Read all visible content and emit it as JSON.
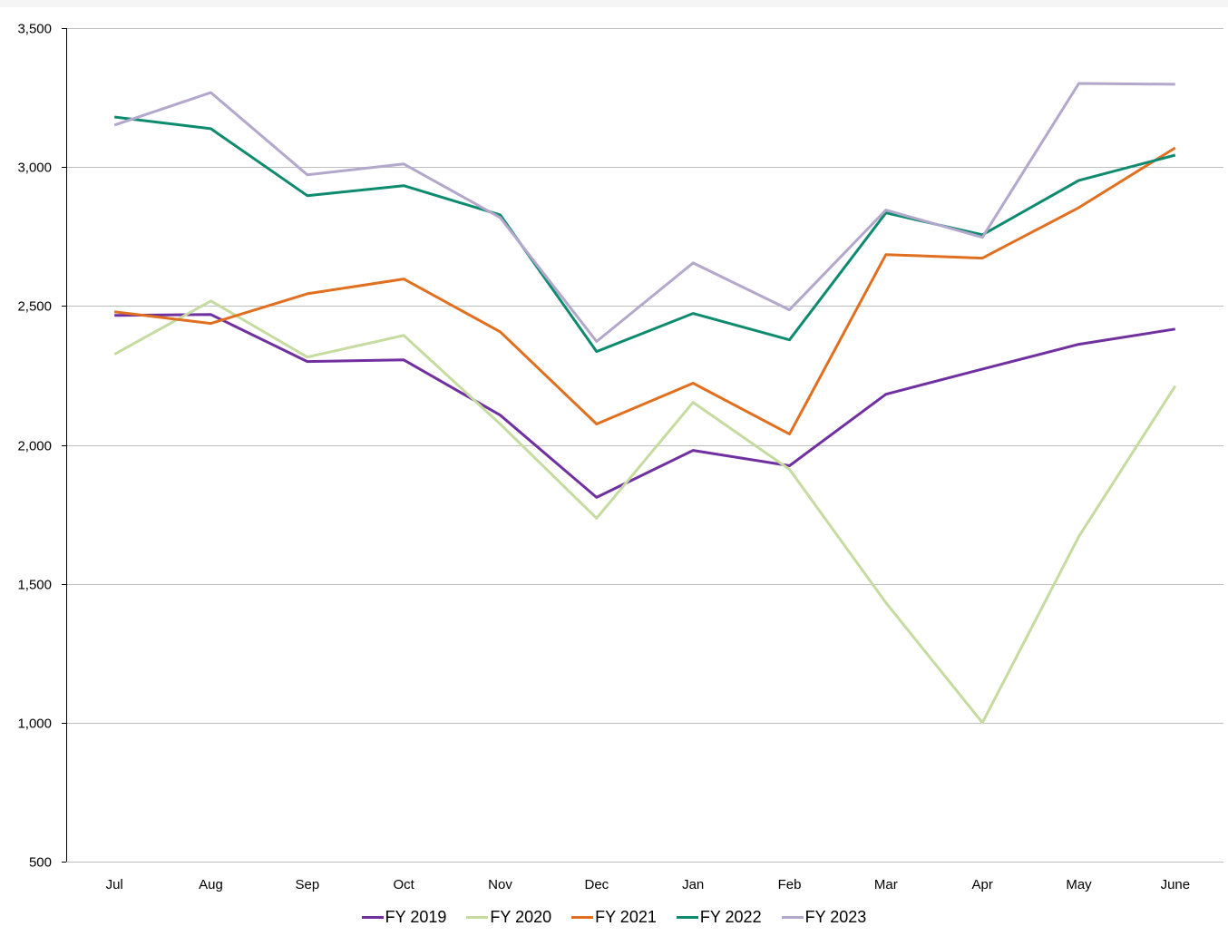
{
  "chart_data": {
    "type": "line",
    "title": "",
    "xlabel": "",
    "ylabel": "",
    "categories": [
      "Jul",
      "Aug",
      "Sep",
      "Oct",
      "Nov",
      "Dec",
      "Jan",
      "Feb",
      "Mar",
      "Apr",
      "May",
      "June"
    ],
    "ylim": [
      500,
      3500
    ],
    "yticks": [
      500,
      1000,
      1500,
      2000,
      2500,
      3000,
      3500
    ],
    "ytick_labels": [
      "500",
      "1,000",
      "1,500",
      "2,000",
      "2,500",
      "3,000",
      "3,500"
    ],
    "grid": "horizontal",
    "legend_position": "bottom",
    "series": [
      {
        "name": "FY 2019",
        "color": "#7030a0",
        "values": [
          2466,
          2469,
          2300,
          2306,
          2107,
          1811,
          1980,
          1925,
          2182,
          2273,
          2362,
          2417
        ]
      },
      {
        "name": "FY 2020",
        "color": "#c5dba0",
        "values": [
          2326,
          2518,
          2316,
          2394,
          2075,
          1736,
          2153,
          1912,
          1432,
          1000,
          1670,
          2212
        ]
      },
      {
        "name": "FY 2021",
        "color": "#e07020",
        "values": [
          2479,
          2437,
          2544,
          2597,
          2407,
          2075,
          2222,
          2039,
          2685,
          2672,
          2854,
          3069
        ]
      },
      {
        "name": "FY 2022",
        "color": "#0e8a6e",
        "values": [
          3180,
          3138,
          2897,
          2933,
          2828,
          2336,
          2473,
          2378,
          2835,
          2756,
          2952,
          3043
        ]
      },
      {
        "name": "FY 2023",
        "color": "#b4a7cc",
        "values": [
          3151,
          3268,
          2972,
          3011,
          2818,
          2372,
          2655,
          2486,
          2845,
          2747,
          3301,
          3298
        ]
      }
    ]
  }
}
